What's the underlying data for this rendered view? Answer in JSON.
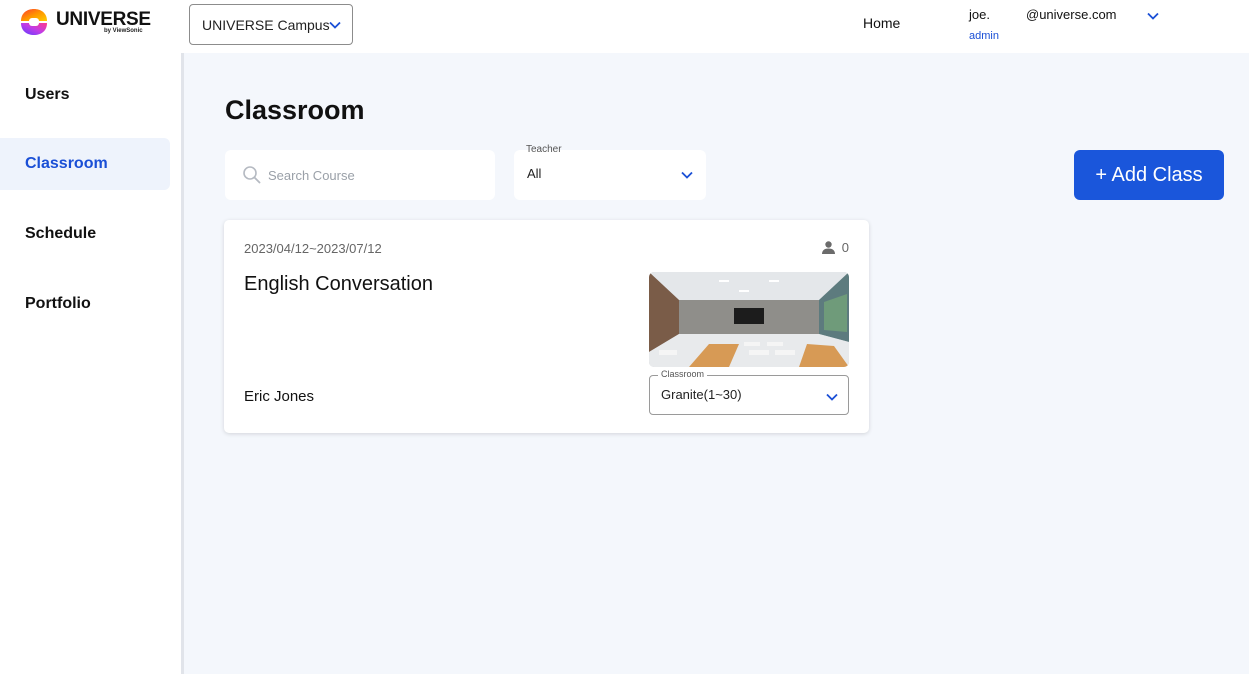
{
  "app": {
    "brand_name": "UNIVERSE",
    "brand_sub": "by ViewSonic",
    "logo_icon": "universe-logo-icon"
  },
  "header": {
    "campus": "UNIVERSE Campus",
    "home_label": "Home",
    "user_name": "joe.",
    "user_email": "@universe.com",
    "user_role": "admin"
  },
  "sidebar": {
    "items": [
      {
        "label": "Users",
        "active": false
      },
      {
        "label": "Classroom",
        "active": true
      },
      {
        "label": "Schedule",
        "active": false
      },
      {
        "label": "Portfolio",
        "active": false
      }
    ]
  },
  "main": {
    "title": "Classroom",
    "search_placeholder": "Search Course",
    "teacher_label": "Teacher",
    "teacher_value": "All",
    "add_button": "+ Add Class"
  },
  "cards": [
    {
      "date_range": "2023/04/12~2023/07/12",
      "student_count": "0",
      "title": "English Conversation",
      "teacher": "Eric Jones",
      "classroom_label": "Classroom",
      "classroom_value": "Granite(1~30)"
    }
  ],
  "colors": {
    "accent": "#1a56db",
    "active_text": "#1a4fd6",
    "active_bg": "#eef3fc",
    "page_bg": "#f4f7fc"
  }
}
